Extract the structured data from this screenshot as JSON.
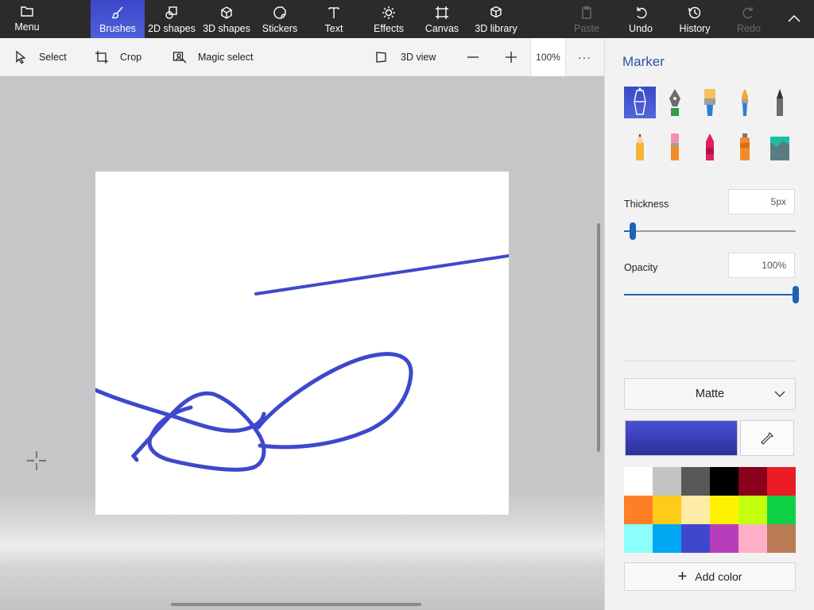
{
  "toolbar": {
    "menu_label": "Menu",
    "tabs": [
      {
        "label": "Brushes",
        "icon": "brush-icon"
      },
      {
        "label": "2D shapes",
        "icon": "shapes-2d-icon"
      },
      {
        "label": "3D shapes",
        "icon": "cube-icon"
      },
      {
        "label": "Stickers",
        "icon": "sticker-icon"
      },
      {
        "label": "Text",
        "icon": "text-icon"
      },
      {
        "label": "Effects",
        "icon": "sun-icon"
      },
      {
        "label": "Canvas",
        "icon": "canvas-icon"
      },
      {
        "label": "3D library",
        "icon": "library-icon"
      }
    ],
    "active_tab": "Brushes",
    "paste_label": "Paste",
    "undo_label": "Undo",
    "history_label": "History",
    "redo_label": "Redo"
  },
  "subtoolbar": {
    "select_label": "Select",
    "crop_label": "Crop",
    "magic_select_label": "Magic select",
    "view3d_label": "3D view",
    "zoom_value": "100%",
    "more_label": "···"
  },
  "panel": {
    "title": "Marker",
    "brushes": [
      "marker-icon",
      "calligraphy-pen-icon",
      "oil-brush-icon",
      "watercolor-icon",
      "pixel-pen-icon",
      "pencil-icon",
      "eraser-icon",
      "crayon-icon",
      "spray-can-icon",
      "fill-bucket-icon"
    ],
    "selected_brush": "marker-icon",
    "thickness_label": "Thickness",
    "thickness_value": "5px",
    "thickness_level": 0.05,
    "opacity_label": "Opacity",
    "opacity_value": "100%",
    "opacity_level": 1.0,
    "finish_value": "Matte",
    "current_color": "#3f48cc",
    "palette": [
      "#ffffff",
      "#c3c3c3",
      "#585858",
      "#000000",
      "#88001b",
      "#ec1c24",
      "#ff7f27",
      "#ffca18",
      "#fdeca6",
      "#fff200",
      "#c4ff0e",
      "#0ed145",
      "#8cfffb",
      "#00a8f3",
      "#3f48cc",
      "#b83dba",
      "#ffaec8",
      "#b97a56"
    ],
    "add_color_label": "Add color"
  },
  "stroke_color": "#3f48cc"
}
